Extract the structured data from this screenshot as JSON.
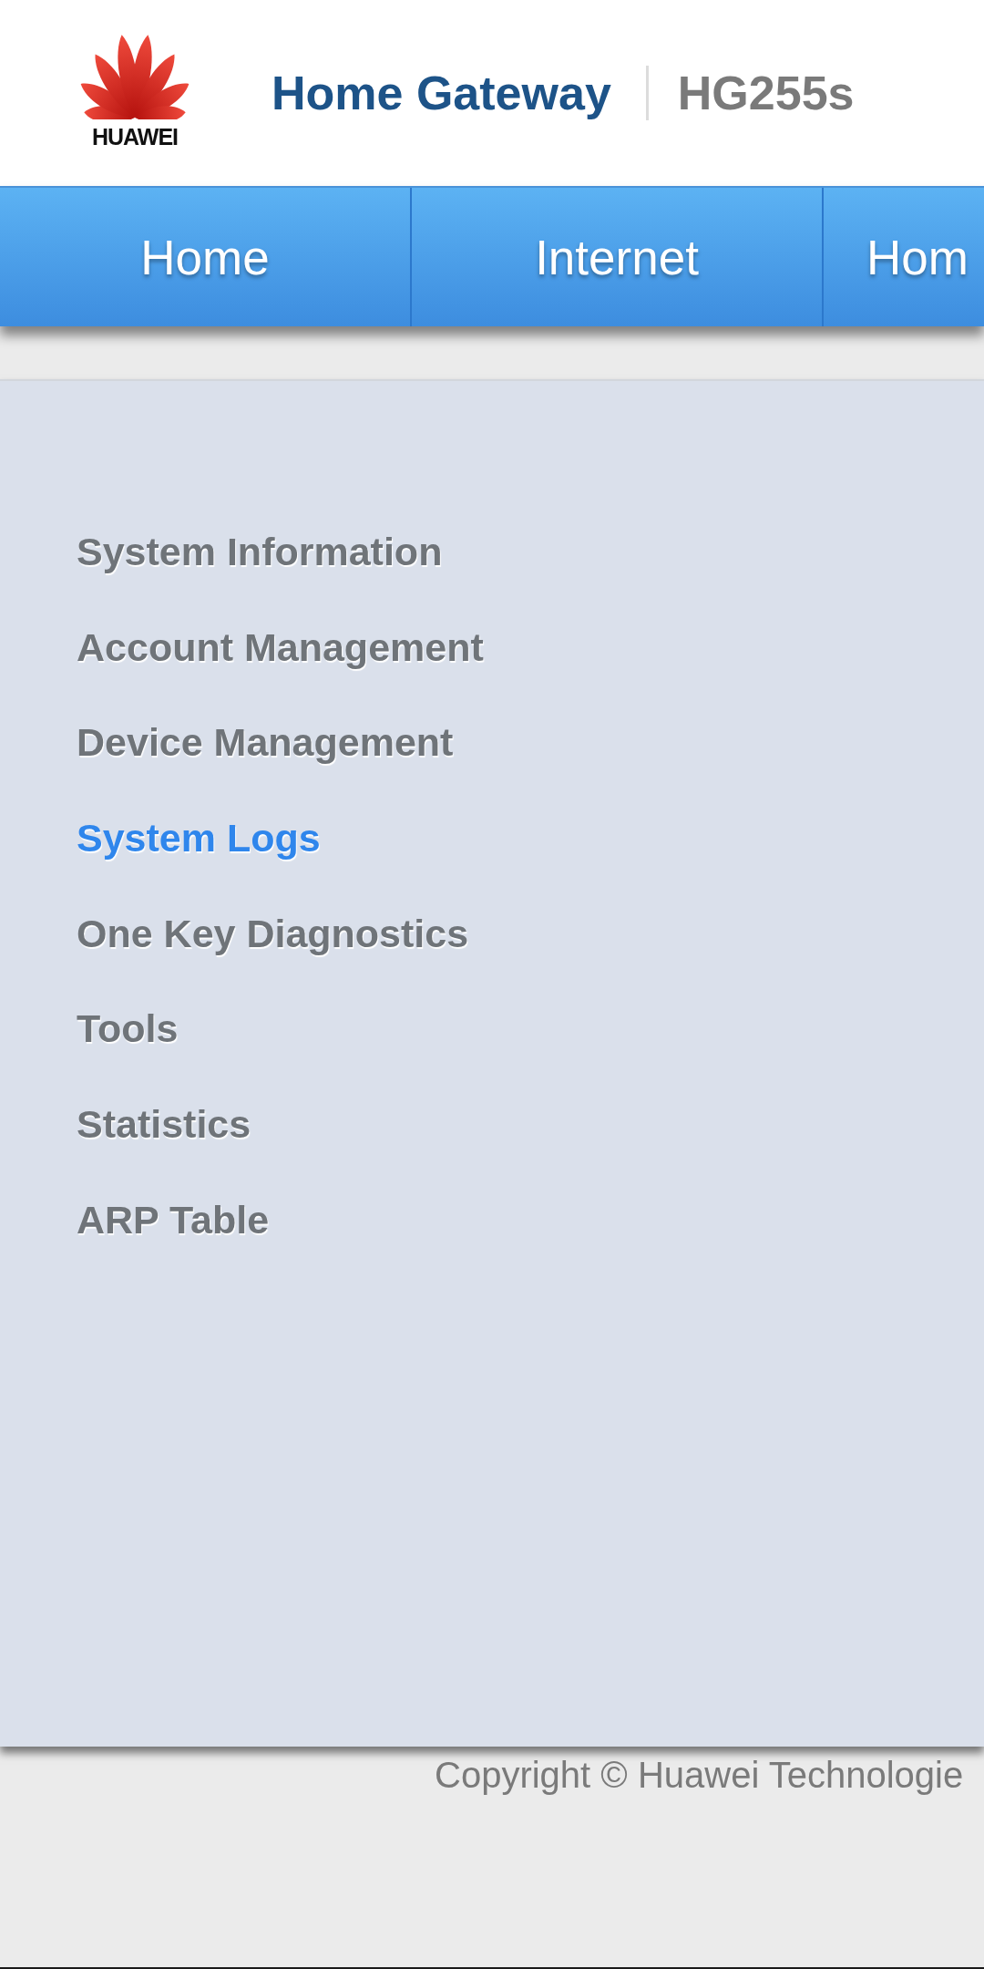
{
  "header": {
    "logo_text": "HUAWEI",
    "title": "Home Gateway",
    "model": "HG255s"
  },
  "nav_tabs": [
    {
      "label": "Home",
      "selected": false
    },
    {
      "label": "Internet",
      "selected": false
    },
    {
      "label": "Hom",
      "selected": false
    }
  ],
  "menu": {
    "items": [
      {
        "label": "System Information",
        "selected": false
      },
      {
        "label": "Account Management",
        "selected": false
      },
      {
        "label": "Device Management",
        "selected": false
      },
      {
        "label": "System Logs",
        "selected": true
      },
      {
        "label": "One Key Diagnostics",
        "selected": false
      },
      {
        "label": "Tools",
        "selected": false
      },
      {
        "label": "Statistics",
        "selected": false
      },
      {
        "label": "ARP Table",
        "selected": false
      }
    ]
  },
  "footer": {
    "copyright": "Copyright © Huawei Technologie"
  }
}
